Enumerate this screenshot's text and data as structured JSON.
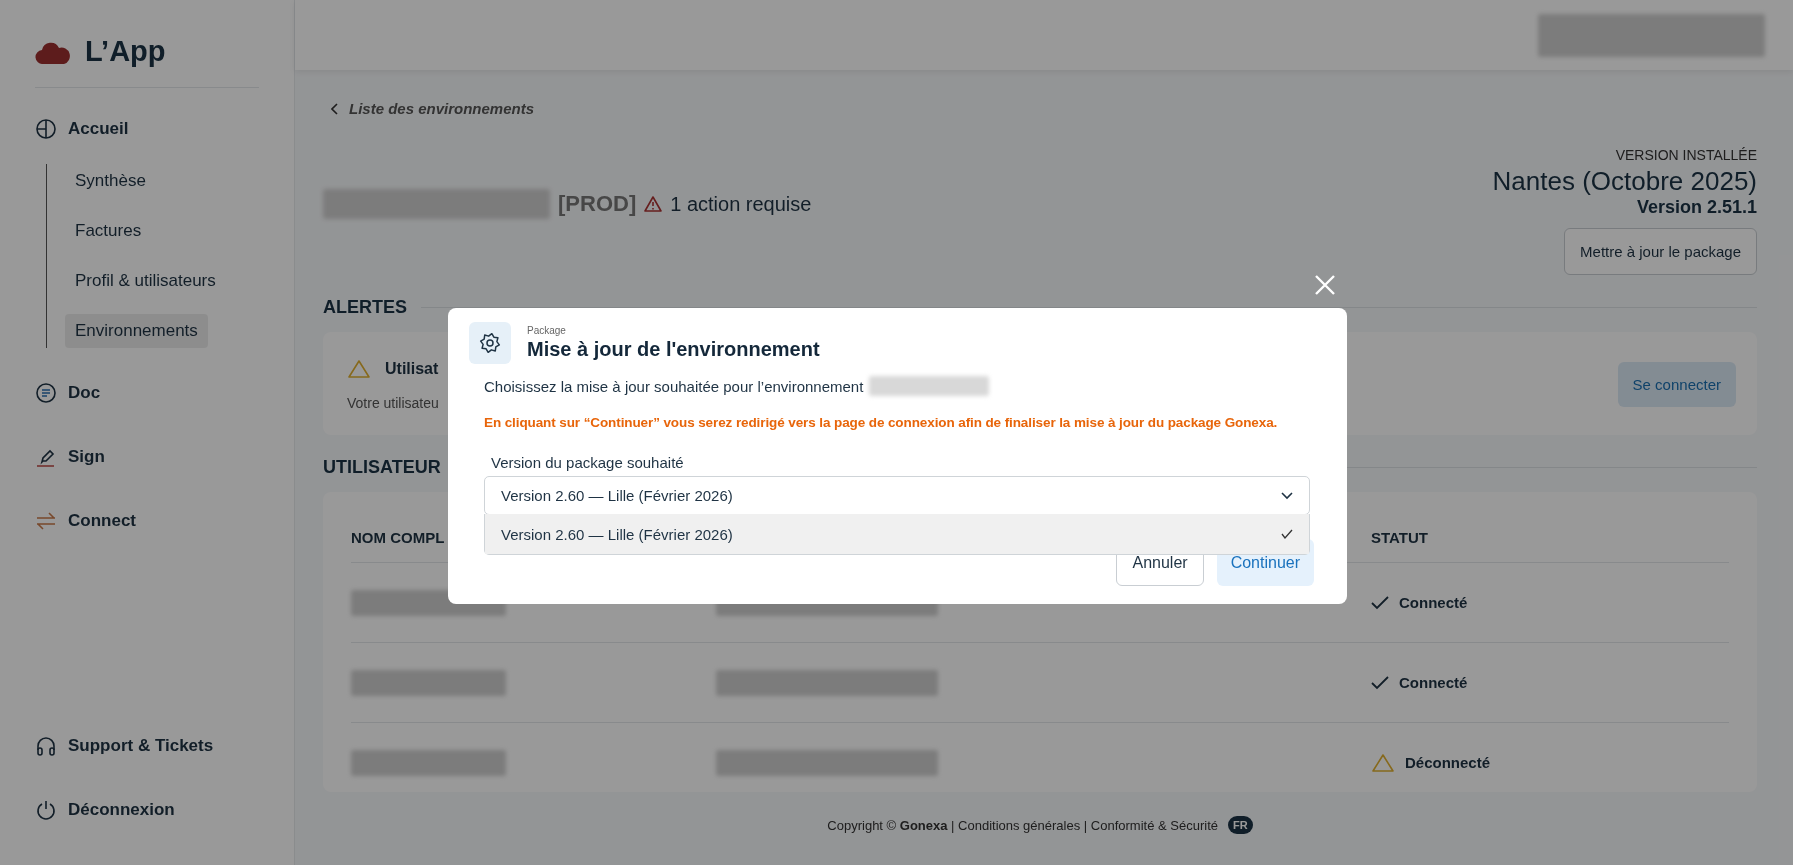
{
  "sidebar": {
    "logo": "L’App",
    "items": [
      {
        "label": "Accueil",
        "children": [
          {
            "label": "Synthèse",
            "selected": false
          },
          {
            "label": "Factures",
            "selected": false
          },
          {
            "label": "Profil & utilisateurs",
            "selected": false
          },
          {
            "label": "Environnements",
            "selected": true
          }
        ]
      },
      {
        "label": "Doc"
      },
      {
        "label": "Sign"
      },
      {
        "label": "Connect"
      }
    ],
    "bottom_items": [
      {
        "label": "Support & Tickets"
      },
      {
        "label": "Déconnexion"
      }
    ]
  },
  "page": {
    "back_link": "Liste des environnements",
    "env_tag": "[PROD]",
    "action": "1 action requise",
    "version_label": "VERSION INSTALLÉE",
    "version_name": "Nantes (Octobre 2025)",
    "version_number": "Version 2.51.1",
    "update_button": "Mettre à jour le package"
  },
  "alerts": {
    "heading": "ALERTES",
    "items": [
      {
        "title": "Utilisat",
        "text": "Votre utilisateu",
        "button": "Se connecter"
      }
    ]
  },
  "users": {
    "heading": "UTILISATEUR",
    "columns": [
      "NOM COMPL",
      "STATUT"
    ],
    "rows": [
      {
        "status": "Connecté",
        "connected": true
      },
      {
        "status": "Connecté",
        "connected": true
      },
      {
        "status": "Déconnecté",
        "connected": false
      }
    ]
  },
  "footer": {
    "text": "Copyright © **Gonexa** | Conditions générales | Conformité & Sécurité",
    "language": "FR"
  },
  "dialog": {
    "eyebrow": "Package",
    "title": "Mise à jour de l'environnement",
    "intro": "Choisissez la mise à jour souhaitée pour l’environnement",
    "warning": "En cliquant sur “Continuer” vous serez redirigé vers la page de connexion afin de finaliser la mise à jour du package Gonexa.",
    "field_label": "Version du package souhaité",
    "select": {
      "value": "Version 2.60 — Lille (Février 2026)",
      "expanded": true,
      "options": [
        {
          "label": "Version 2.60 — Lille (Février 2026)",
          "selected": true
        }
      ]
    },
    "buttons": [
      {
        "label": "Annuler",
        "kind": "secondary"
      },
      {
        "label": "Continuer",
        "kind": "primary"
      }
    ]
  }
}
